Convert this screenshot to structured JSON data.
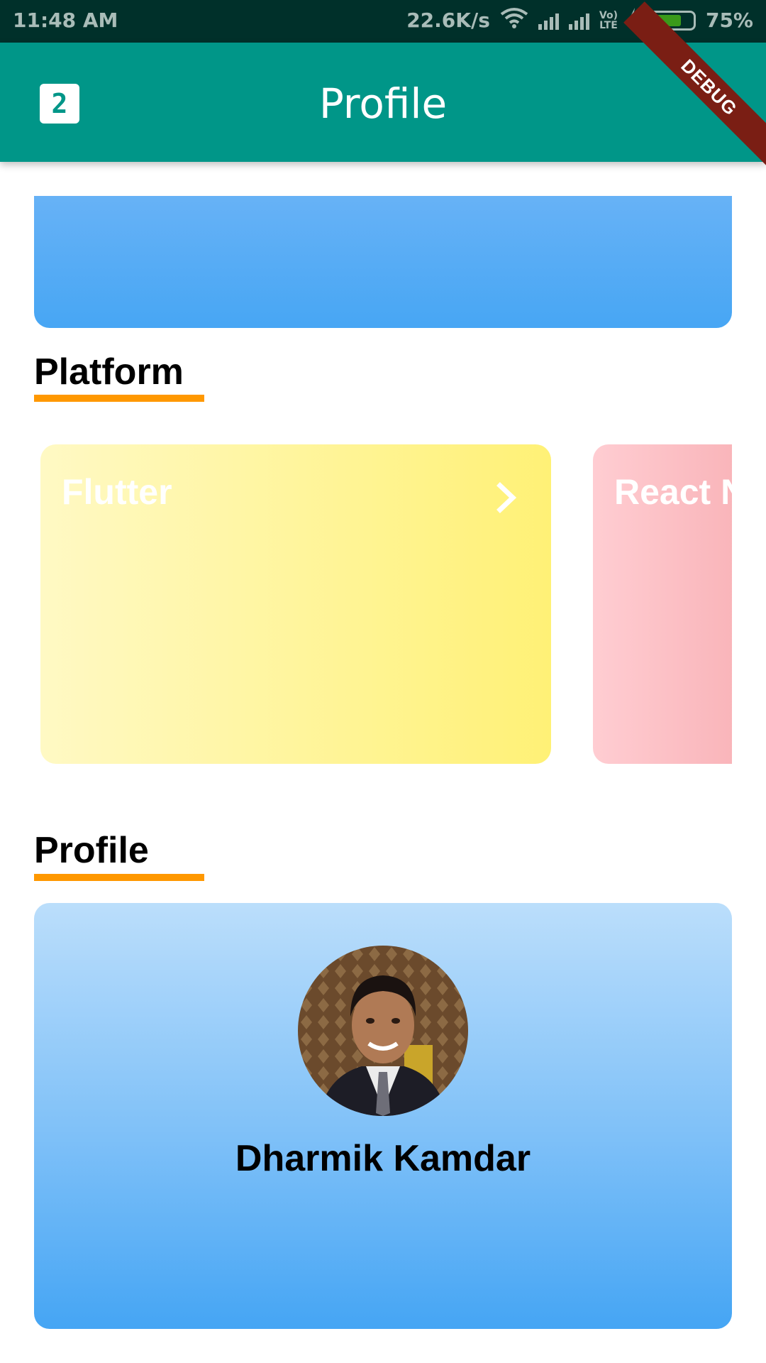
{
  "status_bar": {
    "time": "11:48 AM",
    "net_speed": "22.6K/s",
    "battery_percent": "75%",
    "battery_level": 0.75,
    "icons": [
      "wifi-icon",
      "signal-icon",
      "signal-icon",
      "volte-icon",
      "charging-icon",
      "battery-icon"
    ],
    "volte_label_top": "Vo)",
    "volte_label_bottom": "LTE"
  },
  "app_bar": {
    "logo_text": "2",
    "title": "Profile",
    "debug_label": "DEBUG",
    "color": "#009688"
  },
  "sections": {
    "platform": "Platform",
    "profile": "Profile",
    "underline_color": "#ff9800"
  },
  "platforms": [
    {
      "name": "Flutter",
      "icon": "chevron-right-icon"
    },
    {
      "name": "React N"
    }
  ],
  "profile": {
    "name": "Dharmik Kamdar"
  }
}
